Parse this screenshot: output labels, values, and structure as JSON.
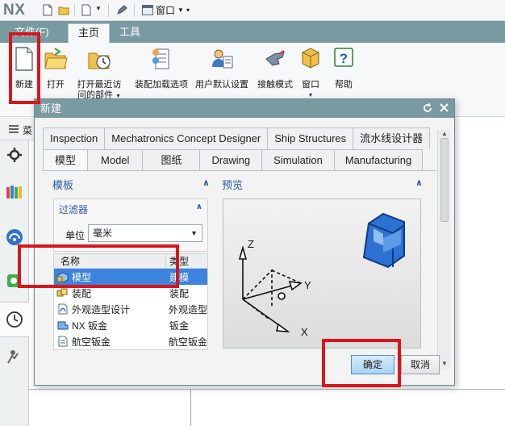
{
  "app": {
    "logo": "NX",
    "window_menu": "窗口"
  },
  "ribbon": {
    "tabs": [
      "文件(F)",
      "主页",
      "工具"
    ],
    "active_tab": "主页",
    "buttons": [
      {
        "label": "新建"
      },
      {
        "label": "打开"
      },
      {
        "label": "打开最近访",
        "label2": "问的部件"
      },
      {
        "label": "装配加载选项"
      },
      {
        "label": "用户默认设置"
      },
      {
        "label": "接触模式"
      },
      {
        "label": "窗口"
      },
      {
        "label": "帮助"
      }
    ]
  },
  "subbar": {
    "label": "菜"
  },
  "dialog": {
    "title": "新建",
    "tabs_row1": [
      "Inspection",
      "Mechatronics Concept Designer",
      "Ship Structures",
      "流水线设计器"
    ],
    "tabs_row2": [
      "模型",
      "Model",
      "图纸",
      "Drawing",
      "Simulation",
      "Manufacturing"
    ],
    "active_tab": "模型",
    "template_section": "模板",
    "filter": {
      "title": "过滤器",
      "unit_label": "单位",
      "unit_value": "毫米"
    },
    "table": {
      "headers": [
        "名称",
        "类型"
      ],
      "rows": [
        {
          "name": "模型",
          "type": "建模",
          "selected": true
        },
        {
          "name": "装配",
          "type": "装配",
          "selected": false
        },
        {
          "name": "外观造型设计",
          "type": "外观造型",
          "selected": false
        },
        {
          "name": "NX 钣金",
          "type": "钣金",
          "selected": false
        },
        {
          "name": "航空钣金",
          "type": "航空钣金",
          "selected": false
        }
      ]
    },
    "preview_section": "预览",
    "axes": {
      "z": "Z",
      "y": "Y",
      "x": "X"
    },
    "ok_label": "确定",
    "cancel_label": "取消"
  },
  "colors": {
    "highlight": "#d8161c",
    "titlebar": "#7a9aa2",
    "selection": "#3a84e0"
  }
}
